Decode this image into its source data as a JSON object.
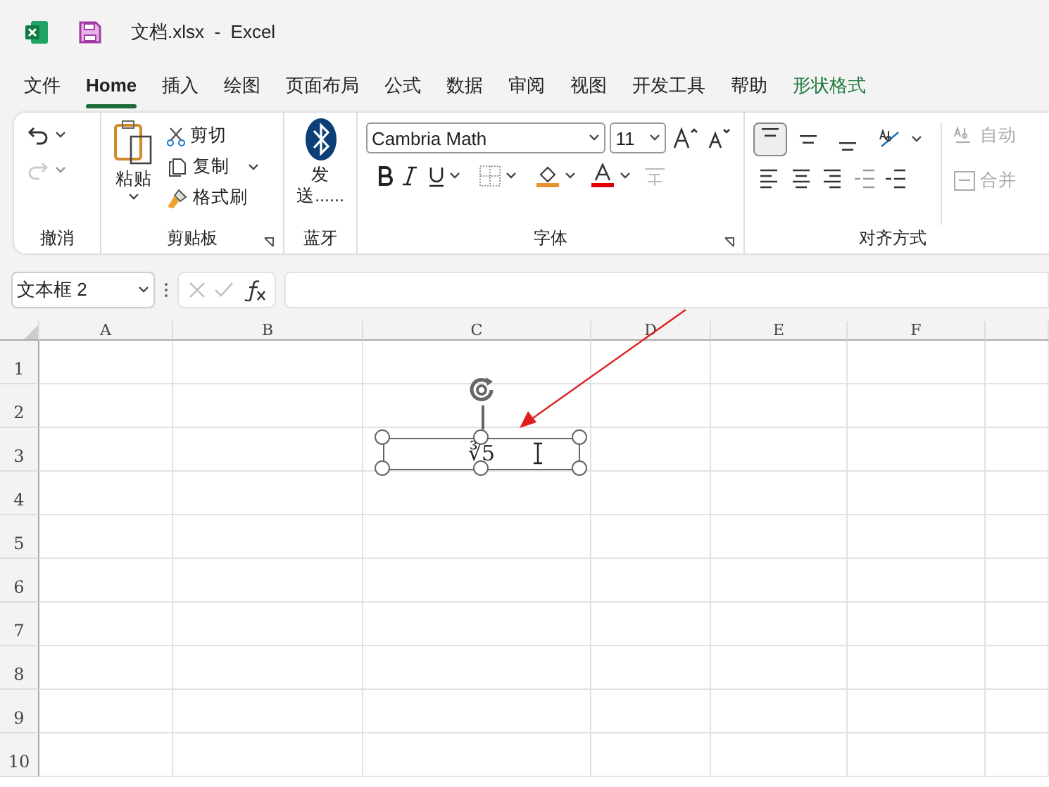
{
  "window": {
    "title": "文档.xlsx  -  Excel"
  },
  "tabs": [
    {
      "label": "文件",
      "selected": false,
      "contextual": false
    },
    {
      "label": "Home",
      "selected": true,
      "contextual": false
    },
    {
      "label": "插入",
      "selected": false,
      "contextual": false
    },
    {
      "label": "绘图",
      "selected": false,
      "contextual": false
    },
    {
      "label": "页面布局",
      "selected": false,
      "contextual": false
    },
    {
      "label": "公式",
      "selected": false,
      "contextual": false
    },
    {
      "label": "数据",
      "selected": false,
      "contextual": false
    },
    {
      "label": "审阅",
      "selected": false,
      "contextual": false
    },
    {
      "label": "视图",
      "selected": false,
      "contextual": false
    },
    {
      "label": "开发工具",
      "selected": false,
      "contextual": false
    },
    {
      "label": "帮助",
      "selected": false,
      "contextual": false
    },
    {
      "label": "形状格式",
      "selected": false,
      "contextual": true
    }
  ],
  "ribbon": {
    "undo": {
      "label": "撤消",
      "undo_disabled": false,
      "redo_disabled": true
    },
    "clipboard": {
      "label": "剪贴板",
      "paste": "粘贴",
      "cut": "剪切",
      "copy": "复制",
      "format_painter": "格式刷"
    },
    "bluetooth": {
      "label": "蓝牙",
      "send_line_1": "发",
      "send_line_2": "送......"
    },
    "font": {
      "label": "字体",
      "font_name": "Cambria Math",
      "font_size": "11"
    },
    "alignment": {
      "label": "对齐方式",
      "vertical": [
        {
          "kind": "top",
          "selected": true
        },
        {
          "kind": "middle",
          "selected": false
        },
        {
          "kind": "bottom",
          "selected": false
        }
      ],
      "wrap_text": {
        "label": "自动",
        "disabled": true
      },
      "merge": {
        "label": "合并",
        "disabled": true
      }
    }
  },
  "formula_bar": {
    "name_box": "文本框 2"
  },
  "sheet": {
    "columns": [
      "A",
      "B",
      "C",
      "D",
      "E",
      "F"
    ],
    "rows": [
      "1",
      "2",
      "3",
      "4",
      "5",
      "6",
      "7",
      "8",
      "9",
      "10"
    ],
    "textbox": {
      "text": "∛5",
      "selected": true
    }
  }
}
